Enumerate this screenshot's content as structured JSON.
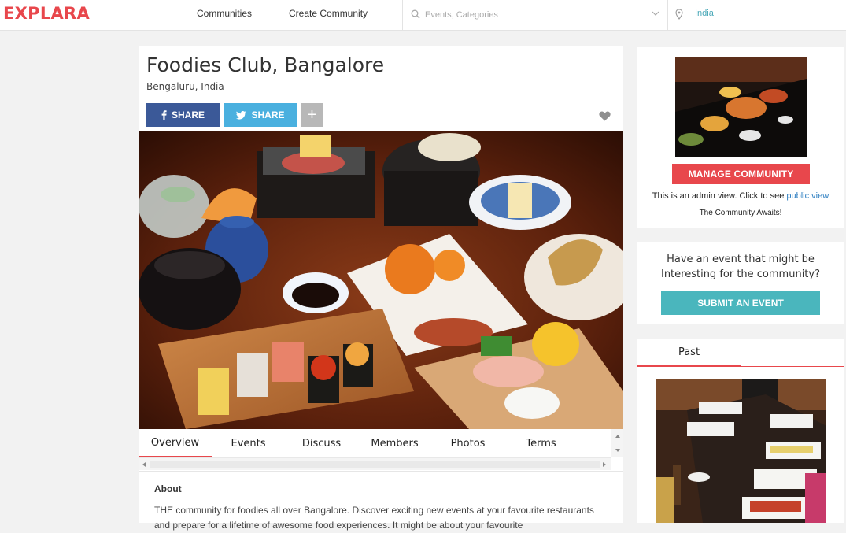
{
  "header": {
    "logo": "EXPLARA",
    "nav": [
      "Communities",
      "Create Community"
    ],
    "search_placeholder": "Events, Categories",
    "location": "India"
  },
  "community": {
    "title": "Foodies Club, Bangalore",
    "location": "Bengaluru, India",
    "share_facebook": "SHARE",
    "share_twitter": "SHARE",
    "share_more": "+"
  },
  "tabs": [
    "Overview",
    "Events",
    "Discuss",
    "Members",
    "Photos",
    "Terms"
  ],
  "about": {
    "heading": "About",
    "text": "THE community for foodies all over Bangalore. Discover exciting new events at your favourite restaurants and prepare for a lifetime of awesome food experiences. It might be about your favourite"
  },
  "sidebar": {
    "manage_label": "MANAGE COMMUNITY",
    "admin_note_prefix": "This is an admin view. Click to see",
    "admin_note_link": "public view",
    "awaits": "The Community Awaits!",
    "event_question": "Have an event that might be Interesting for the community?",
    "submit_label": "SUBMIT AN EVENT",
    "past_tab": "Past"
  },
  "colors": {
    "brand": "#e8474c",
    "facebook": "#3b5998",
    "twitter": "#4ab0df",
    "teal": "#4ab6bd"
  }
}
